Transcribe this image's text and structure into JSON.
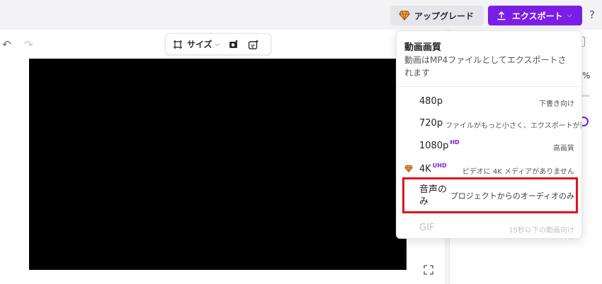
{
  "topbar": {
    "upgrade_label": "アップグレード",
    "export_label": "エクスポート",
    "help_label": "?"
  },
  "toolbar": {
    "size_label": "サイズ"
  },
  "export_menu": {
    "title": "動画画質",
    "description": "動画はMP4ファイルとしてエクスポートされます",
    "options": [
      {
        "name": "480p",
        "badge": "",
        "desc": "下書き向け"
      },
      {
        "name": "720p",
        "badge": "",
        "desc": "ファイルがもっと小さく、エクスポートが速い"
      },
      {
        "name": "1080p",
        "badge": "HD",
        "desc": "高画質"
      },
      {
        "name": "4K",
        "badge": "UHD",
        "desc": "ビデオに 4K メディアがありません"
      },
      {
        "name": "音声のみ",
        "badge": "",
        "desc": "プロジェクトからのオーディオのみ"
      },
      {
        "name": "GIF",
        "badge": "",
        "desc": "15秒以下の動画向け"
      }
    ]
  },
  "right_panel": {
    "percent_symbol": "%"
  },
  "colors": {
    "accent": "#7a1ee6",
    "highlight": "#e0141f",
    "gem": "#e08a1e"
  }
}
